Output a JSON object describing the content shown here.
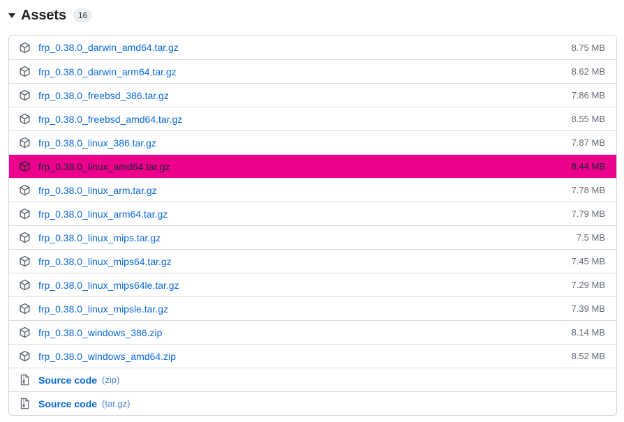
{
  "header": {
    "disclosure_icon": "triangle-down-icon",
    "title": "Assets",
    "count": "16"
  },
  "colors": {
    "link": "#0969da",
    "highlight_background": "#ec008c",
    "highlight_text": "#1a1f36",
    "border": "#d0d7de",
    "row_divider": "#d8dee4",
    "size_text": "#636c76",
    "badge_background": "#eaeef2"
  },
  "assets": [
    {
      "icon": "package-icon",
      "name": "frp_0.38.0_darwin_amd64.tar.gz",
      "suffix": "",
      "size": "8.75 MB",
      "highlighted": false,
      "bold": false
    },
    {
      "icon": "package-icon",
      "name": "frp_0.38.0_darwin_arm64.tar.gz",
      "suffix": "",
      "size": "8.62 MB",
      "highlighted": false,
      "bold": false
    },
    {
      "icon": "package-icon",
      "name": "frp_0.38.0_freebsd_386.tar.gz",
      "suffix": "",
      "size": "7.86 MB",
      "highlighted": false,
      "bold": false
    },
    {
      "icon": "package-icon",
      "name": "frp_0.38.0_freebsd_amd64.tar.gz",
      "suffix": "",
      "size": "8.55 MB",
      "highlighted": false,
      "bold": false
    },
    {
      "icon": "package-icon",
      "name": "frp_0.38.0_linux_386.tar.gz",
      "suffix": "",
      "size": "7.87 MB",
      "highlighted": false,
      "bold": false
    },
    {
      "icon": "package-icon",
      "name": "frp_0.38.0_linux_amd64.tar.gz",
      "suffix": "",
      "size": "8.44 MB",
      "highlighted": true,
      "bold": false
    },
    {
      "icon": "package-icon",
      "name": "frp_0.38.0_linux_arm.tar.gz",
      "suffix": "",
      "size": "7.78 MB",
      "highlighted": false,
      "bold": false
    },
    {
      "icon": "package-icon",
      "name": "frp_0.38.0_linux_arm64.tar.gz",
      "suffix": "",
      "size": "7.79 MB",
      "highlighted": false,
      "bold": false
    },
    {
      "icon": "package-icon",
      "name": "frp_0.38.0_linux_mips.tar.gz",
      "suffix": "",
      "size": "7.5 MB",
      "highlighted": false,
      "bold": false
    },
    {
      "icon": "package-icon",
      "name": "frp_0.38.0_linux_mips64.tar.gz",
      "suffix": "",
      "size": "7.45 MB",
      "highlighted": false,
      "bold": false
    },
    {
      "icon": "package-icon",
      "name": "frp_0.38.0_linux_mips64le.tar.gz",
      "suffix": "",
      "size": "7.29 MB",
      "highlighted": false,
      "bold": false
    },
    {
      "icon": "package-icon",
      "name": "frp_0.38.0_linux_mipsle.tar.gz",
      "suffix": "",
      "size": "7.39 MB",
      "highlighted": false,
      "bold": false
    },
    {
      "icon": "package-icon",
      "name": "frp_0.38.0_windows_386.zip",
      "suffix": "",
      "size": "8.14 MB",
      "highlighted": false,
      "bold": false
    },
    {
      "icon": "package-icon",
      "name": "frp_0.38.0_windows_amd64.zip",
      "suffix": "",
      "size": "8.52 MB",
      "highlighted": false,
      "bold": false
    },
    {
      "icon": "file-zip-icon",
      "name": "Source code",
      "suffix": "(zip)",
      "size": "",
      "highlighted": false,
      "bold": true
    },
    {
      "icon": "file-zip-icon",
      "name": "Source code",
      "suffix": "(tar.gz)",
      "size": "",
      "highlighted": false,
      "bold": true
    }
  ]
}
